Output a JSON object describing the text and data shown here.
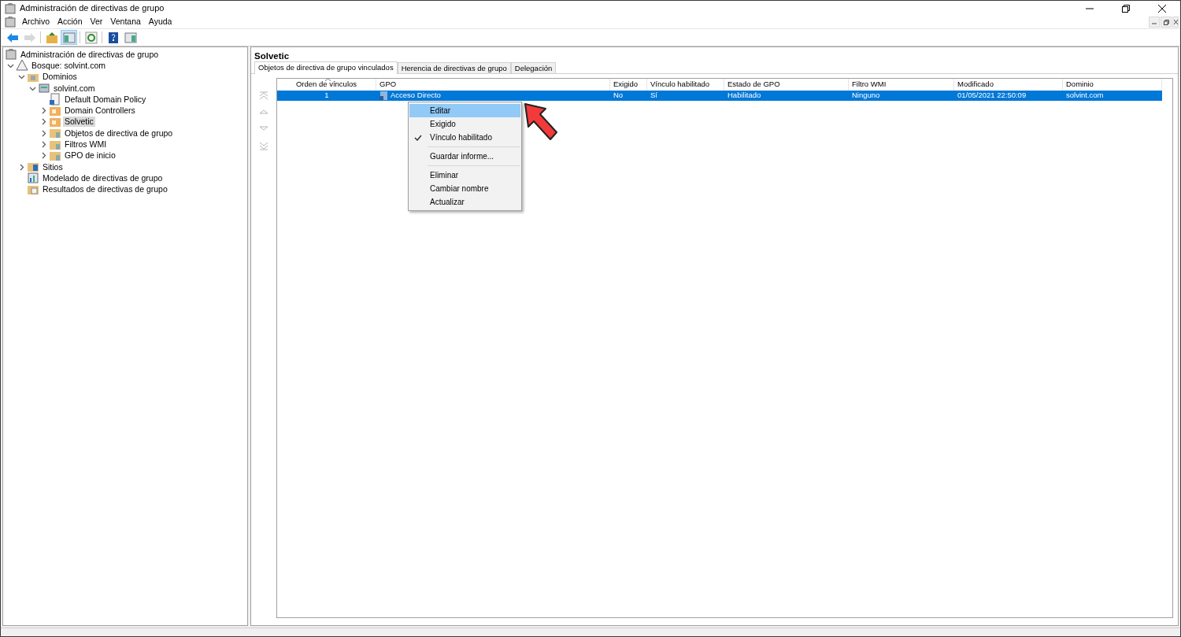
{
  "window": {
    "title": "Administración de directivas de grupo"
  },
  "menu_bar": [
    "Archivo",
    "Acción",
    "Ver",
    "Ventana",
    "Ayuda"
  ],
  "toolbar": [
    {
      "kind": "back",
      "disabled": false,
      "pressed": false
    },
    {
      "kind": "forward",
      "disabled": true,
      "pressed": false
    },
    {
      "kind": "up",
      "disabled": false,
      "pressed": false
    },
    {
      "kind": "tree",
      "disabled": false,
      "pressed": true
    },
    {
      "kind": "refresh",
      "disabled": false,
      "pressed": false
    },
    {
      "kind": "help",
      "disabled": false,
      "pressed": false
    },
    {
      "kind": "pane",
      "disabled": false,
      "pressed": false
    }
  ],
  "tree": [
    {
      "label": "Administración de directivas de grupo",
      "kind": "console",
      "selected": false,
      "children": [
        {
          "label": "Bosque: solvint.com",
          "kind": "forest",
          "selected": false,
          "expanded": true,
          "children": [
            {
              "label": "Dominios",
              "kind": "domains",
              "selected": false,
              "expanded": true,
              "children": [
                {
                  "label": "solvint.com",
                  "kind": "domain",
                  "selected": false,
                  "expanded": true,
                  "children": [
                    {
                      "label": "Default Domain Policy",
                      "kind": "link",
                      "selected": false
                    },
                    {
                      "label": "Domain Controllers",
                      "kind": "ou",
                      "selected": false,
                      "expanded": false
                    },
                    {
                      "label": "Solvetic",
                      "kind": "ou",
                      "selected": true,
                      "expanded": false
                    },
                    {
                      "label": "Objetos de directiva de grupo",
                      "kind": "folder",
                      "selected": false,
                      "expanded": false
                    },
                    {
                      "label": "Filtros WMI",
                      "kind": "folder",
                      "selected": false,
                      "expanded": false
                    },
                    {
                      "label": "GPO de inicio",
                      "kind": "folder",
                      "selected": false,
                      "expanded": false
                    }
                  ]
                }
              ]
            },
            {
              "label": "Sitios",
              "kind": "sites",
              "selected": false,
              "expanded": false
            },
            {
              "label": "Modelado de directivas de grupo",
              "kind": "modeling",
              "selected": false
            },
            {
              "label": "Resultados de directivas de grupo",
              "kind": "results",
              "selected": false
            }
          ]
        }
      ]
    }
  ],
  "details": {
    "title": "Solvetic",
    "tabs": [
      {
        "label": "Objetos de directiva de grupo vinculados",
        "selected": true
      },
      {
        "label": "Herencia de directivas de grupo",
        "selected": false
      },
      {
        "label": "Delegación",
        "selected": false
      }
    ],
    "order_buttons": [
      {
        "kind": "top",
        "disabled": true
      },
      {
        "kind": "up",
        "disabled": true
      },
      {
        "kind": "down",
        "disabled": true
      },
      {
        "kind": "bottom",
        "disabled": true
      }
    ],
    "table": {
      "columns": [
        "Orden de vínculos",
        "GPO",
        "Exigido",
        "Vínculo habilitado",
        "Estado de GPO",
        "Filtro WMI",
        "Modificado",
        "Dominio"
      ],
      "rows": [
        {
          "selected": true,
          "cells": [
            "1",
            "Acceso Directo",
            "No",
            "Sí",
            "Habilitado",
            "Ninguno",
            "01/05/2021 22:50:09",
            "solvint.com"
          ]
        }
      ]
    }
  },
  "context_menu": [
    [
      {
        "label": "Editar",
        "selected": true,
        "checked": false
      },
      {
        "label": "Exigido",
        "selected": false,
        "checked": false
      },
      {
        "label": "Vínculo habilitado",
        "selected": false,
        "checked": true
      }
    ],
    [
      {
        "label": "Guardar informe...",
        "selected": false,
        "checked": false
      }
    ],
    [
      {
        "label": "Eliminar",
        "selected": false,
        "checked": false
      },
      {
        "label": "Cambiar nombre",
        "selected": false,
        "checked": false
      },
      {
        "label": "Actualizar",
        "selected": false,
        "checked": false
      }
    ]
  ]
}
